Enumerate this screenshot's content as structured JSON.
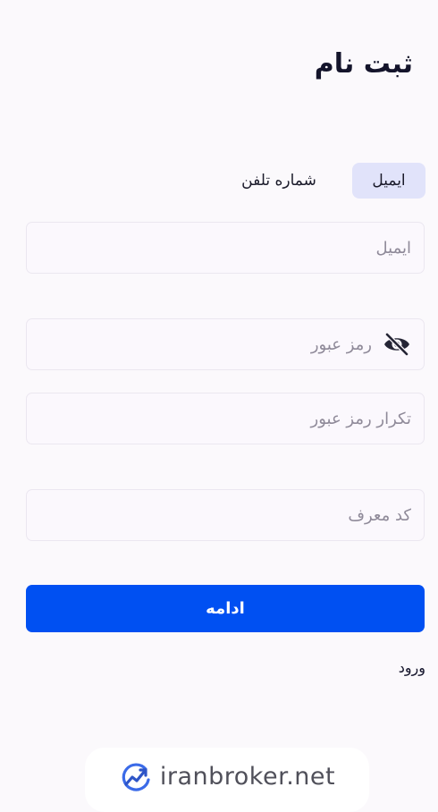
{
  "header": {
    "title": "ثبت نام"
  },
  "tabs": {
    "email_label": "ایمیل",
    "phone_label": "شماره تلفن",
    "active": "email"
  },
  "form": {
    "email_placeholder": "ایمیل",
    "password_placeholder": "رمز عبور",
    "confirm_password_placeholder": "تکرار رمز عبور",
    "referral_placeholder": "کد معرف",
    "password_toggle_icon": "eye-off-icon"
  },
  "actions": {
    "continue_label": "ادامه",
    "login_label": "ورود"
  },
  "watermark": {
    "text": "iranbroker.net",
    "logo_icon": "trend-chart-logo"
  },
  "colors": {
    "primary": "#0050f2",
    "active_tab_bg": "#e1e3fa",
    "page_bg": "#fbf9fc",
    "title": "#14142b"
  }
}
